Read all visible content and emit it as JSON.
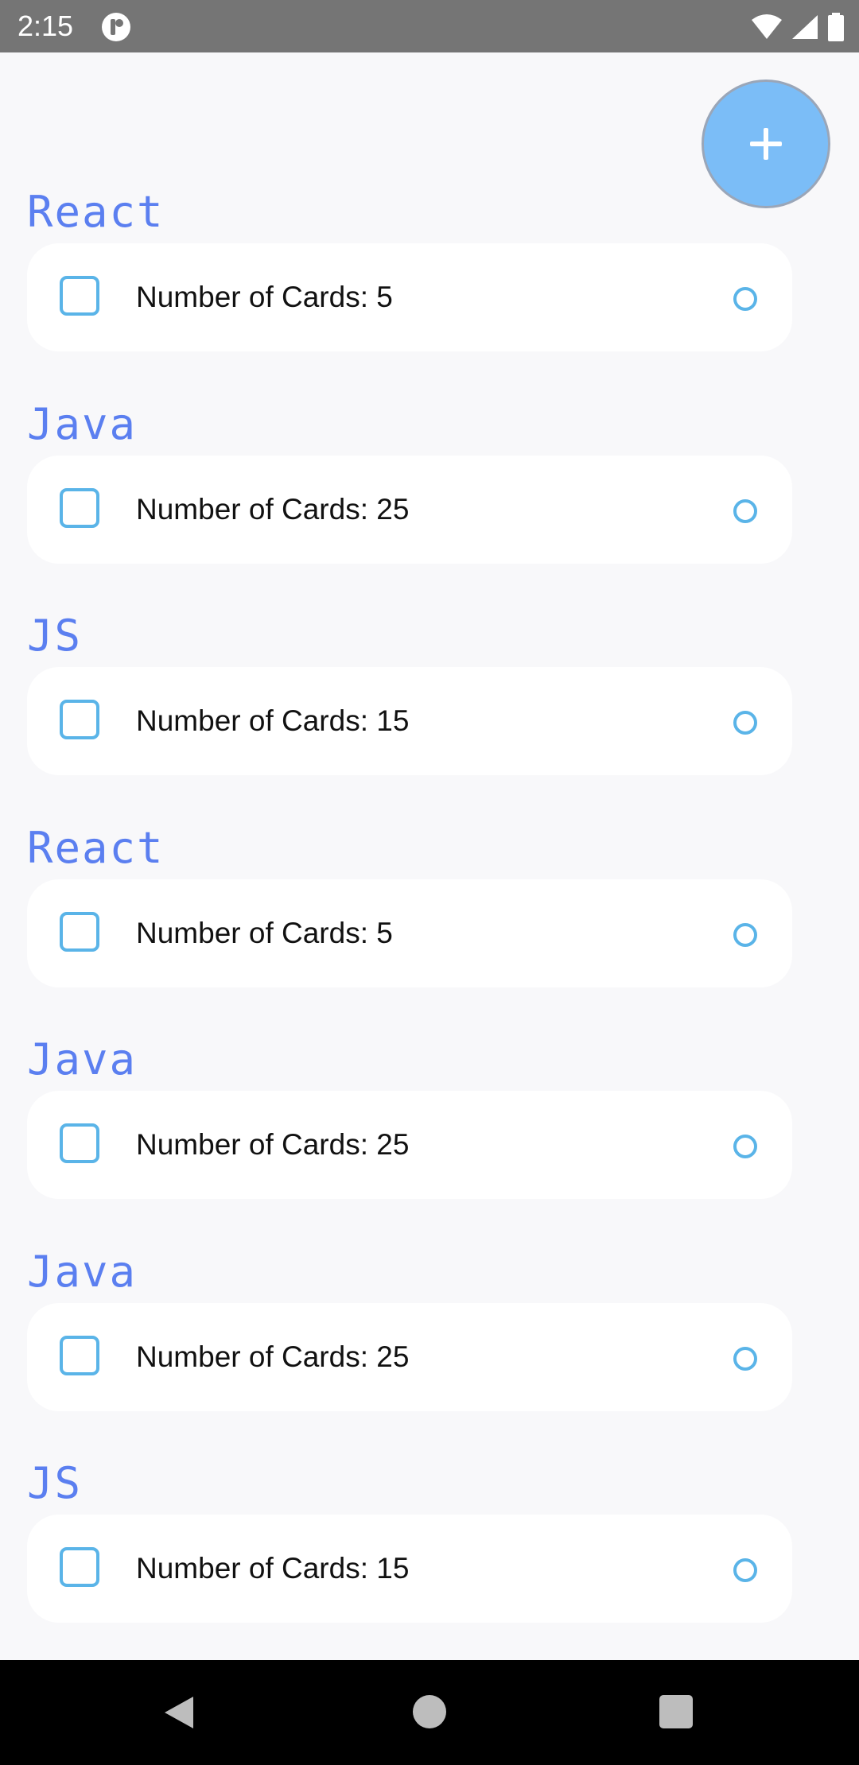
{
  "status_bar": {
    "time": "2:15",
    "icons": [
      "app-notification-icon",
      "wifi-icon",
      "cellular-signal-icon",
      "battery-icon"
    ]
  },
  "fab": {
    "icon": "plus-icon",
    "color": "#7bbdf7"
  },
  "decks": [
    {
      "title": "React",
      "count_text": "Number of Cards: 5"
    },
    {
      "title": "Java",
      "count_text": "Number of Cards: 25"
    },
    {
      "title": "JS",
      "count_text": "Number of Cards: 15"
    },
    {
      "title": "React",
      "count_text": "Number of Cards: 5"
    },
    {
      "title": "Java",
      "count_text": "Number of Cards: 25"
    },
    {
      "title": "Java",
      "count_text": "Number of Cards: 25"
    },
    {
      "title": "JS",
      "count_text": "Number of Cards: 15"
    }
  ],
  "colors": {
    "title": "#5b7ff0",
    "accent": "#5ab4e8",
    "card": "#ffffff",
    "background": "#f8f8fa"
  },
  "nav_bar": {
    "icons": [
      "back-icon",
      "home-icon",
      "recents-icon"
    ]
  }
}
